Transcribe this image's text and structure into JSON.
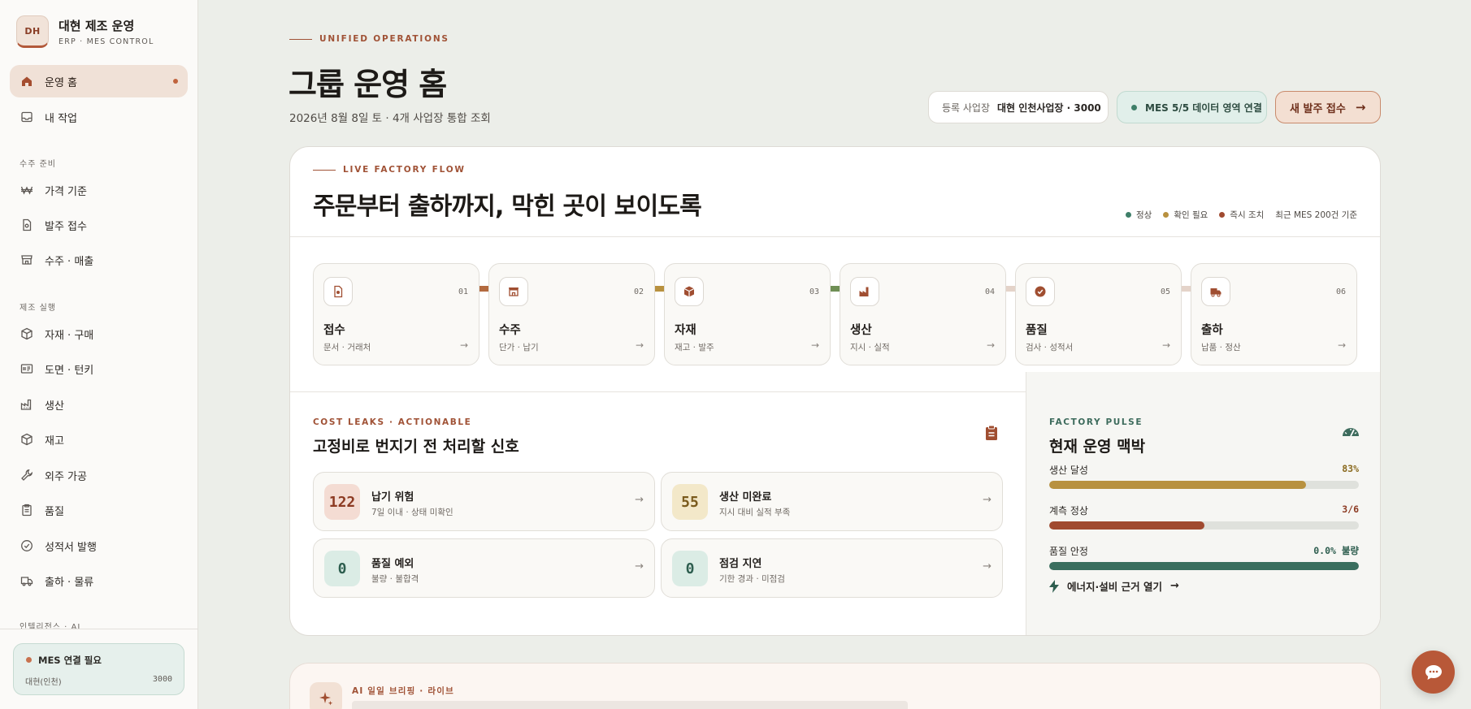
{
  "brand": {
    "logo": "DH",
    "title": "대현 제조 운영",
    "subtitle": "ERP · MES CONTROL"
  },
  "sidebar": {
    "items": [
      {
        "label": "운영 홈",
        "icon": "home-icon"
      },
      {
        "label": "내 작업",
        "icon": "inbox-icon"
      },
      {
        "label": "가격 기준",
        "icon": "won-icon"
      },
      {
        "label": "발주 접수",
        "icon": "document-icon"
      },
      {
        "label": "수주 · 매출",
        "icon": "store-icon"
      },
      {
        "label": "자재 · 구매",
        "icon": "box-icon"
      },
      {
        "label": "도면 · 턴키",
        "icon": "drawing-icon"
      },
      {
        "label": "생산",
        "icon": "factory-icon"
      },
      {
        "label": "재고",
        "icon": "package-icon"
      },
      {
        "label": "외주 가공",
        "icon": "wrench-icon"
      },
      {
        "label": "품질",
        "icon": "clipboard-icon"
      },
      {
        "label": "성적서 발행",
        "icon": "check-circle-icon"
      },
      {
        "label": "출하 · 물류",
        "icon": "truck-icon"
      }
    ],
    "sections": [
      "수주 준비",
      "제조 실행",
      "인텔리전스 · AI"
    ],
    "mes_card": {
      "title": "MES 연결 필요",
      "site": "대현(인천)",
      "code": "3000"
    }
  },
  "header": {
    "eyebrow": "UNIFIED OPERATIONS",
    "title": "그룹 운영 홈",
    "subtitle": "2026년 8월 8일 토 · 4개 사업장 통합 조회",
    "site_label": "등록 사업장",
    "site_value": "대현 인천사업장 · 3000",
    "mes_status": "MES 5/5 데이터 영역 연결",
    "order_button": "새 발주 접수"
  },
  "flow": {
    "eyebrow": "LIVE FACTORY FLOW",
    "title": "주문부터 출하까지, 막힌 곳이 보이도록",
    "legend": {
      "ok": "정상",
      "check": "확인 필요",
      "urgent": "즉시 조치",
      "basis": "최근 MES 200건 기준",
      "color_ok": "#3f7f69",
      "color_check": "#b8913f",
      "color_urgent": "#a04a30"
    },
    "stages": [
      {
        "num": "01",
        "name": "접수",
        "desc": "문서 · 거래처",
        "icon": "document-search-icon"
      },
      {
        "num": "02",
        "name": "수주",
        "desc": "단가 · 납기",
        "icon": "store-icon"
      },
      {
        "num": "03",
        "name": "자재",
        "desc": "재고 · 발주",
        "icon": "box-icon"
      },
      {
        "num": "04",
        "name": "생산",
        "desc": "지시 · 실적",
        "icon": "factory-icon"
      },
      {
        "num": "05",
        "name": "품질",
        "desc": "검사 · 성적서",
        "icon": "badge-check-icon"
      },
      {
        "num": "06",
        "name": "출하",
        "desc": "납품 · 정산",
        "icon": "truck-icon"
      }
    ],
    "connector_colors": [
      "#b36a3f",
      "#b8913f",
      "#6f8f55",
      "#e4d3c9",
      "#e4d3c9"
    ]
  },
  "cost": {
    "eyebrow": "COST LEAKS · ACTIONABLE",
    "title": "고정비로 번지기 전 처리할 신호",
    "items": [
      {
        "value": "122",
        "title": "납기 위험",
        "desc": "7일 이내 · 상태 미확인",
        "bg": "#f4dcd3",
        "fg": "#8c3a22"
      },
      {
        "value": "55",
        "title": "생산 미완료",
        "desc": "지시 대비 실적 부족",
        "bg": "#f3e8c9",
        "fg": "#7a5a1c"
      },
      {
        "value": "0",
        "title": "품질 예외",
        "desc": "불량 · 불합격",
        "bg": "#dbece5",
        "fg": "#2e5e4f"
      },
      {
        "value": "0",
        "title": "점검 지연",
        "desc": "기한 경과 · 미점검",
        "bg": "#dbece5",
        "fg": "#2e5e4f"
      }
    ]
  },
  "pulse": {
    "eyebrow": "FACTORY PULSE",
    "title": "현재 운영 맥박",
    "metrics": [
      {
        "label": "생산 달성",
        "value": "83%",
        "fill": 0.83,
        "color": "#b8913f",
        "val_color": "#8a6a1e"
      },
      {
        "label": "계측 정상",
        "value": "3/6",
        "fill": 0.5,
        "color": "#a04a30",
        "val_color": "#8c3a22"
      },
      {
        "label": "품질 안정",
        "value": "0.0% 불량",
        "fill": 1.0,
        "color": "#3a6e5e",
        "val_color": "#2e5e4f"
      }
    ],
    "link": "에너지·설비 근거 열기"
  },
  "ai": {
    "label": "AI 일일 브리핑 · 라이브"
  }
}
